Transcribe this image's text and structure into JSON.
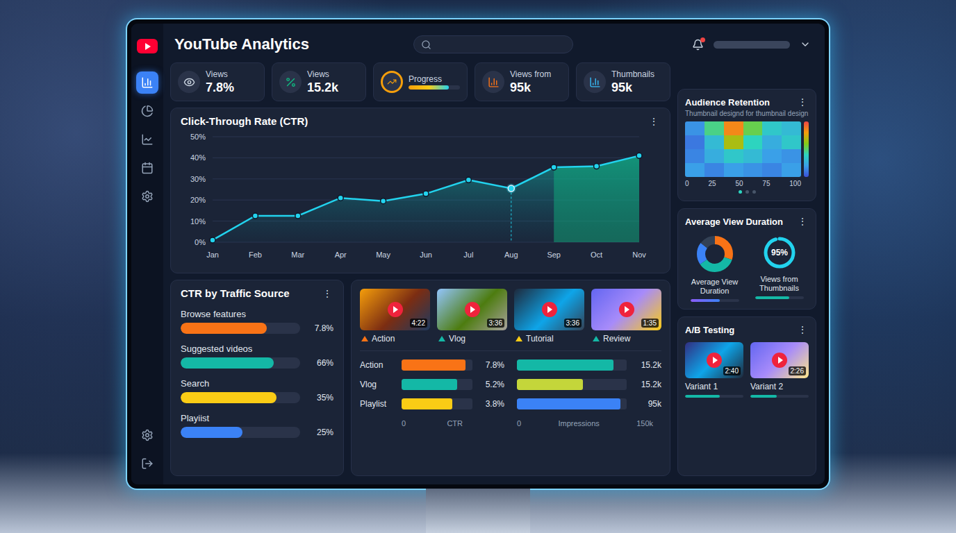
{
  "app": {
    "title": "YouTube Analytics"
  },
  "sidebar": {
    "items": [
      {
        "selected": true
      },
      {
        "selected": false
      },
      {
        "selected": false
      },
      {
        "selected": false
      },
      {
        "selected": false
      }
    ],
    "bottom_items": [
      {
        "selected": false
      },
      {
        "selected": false
      }
    ]
  },
  "notifications": {
    "unread": true
  },
  "stats": [
    {
      "kind": "stat",
      "label": "Views",
      "value": "7.8%"
    },
    {
      "kind": "stat",
      "label": "Views",
      "value": "15.2k"
    },
    {
      "kind": "progress",
      "label": "Progress",
      "level": 0.78
    },
    {
      "kind": "stat",
      "label": "Views from",
      "value": "95k"
    },
    {
      "kind": "stat",
      "label": "Thumbnails",
      "value": "95k"
    }
  ],
  "ctr_chart": {
    "title": "Click-Through Rate (CTR)",
    "menu": "⋮",
    "y_ticks": [
      "50%",
      "40%",
      "30%",
      "20%",
      "10%",
      "0%"
    ],
    "y_max": 50,
    "months": [
      {
        "label": "Jan",
        "selected": false,
        "shaded": false
      },
      {
        "label": "Feb",
        "selected": false,
        "shaded": false
      },
      {
        "label": "Mar",
        "selected": false,
        "shaded": false
      },
      {
        "label": "Apr",
        "selected": false,
        "shaded": false
      },
      {
        "label": "May",
        "selected": false,
        "shaded": false
      },
      {
        "label": "Jun",
        "selected": false,
        "shaded": false
      },
      {
        "label": "Jul",
        "selected": false,
        "shaded": false
      },
      {
        "label": "Aug",
        "selected": true,
        "shaded": false
      },
      {
        "label": "Sep",
        "selected": false,
        "shaded": true
      },
      {
        "label": "Oct",
        "selected": false,
        "shaded": true
      },
      {
        "label": "Nov",
        "selected": false,
        "shaded": true
      }
    ],
    "series": [
      {
        "values": [
          1,
          12.5,
          12.5,
          21,
          19.5,
          23,
          29.5,
          25.5,
          35.5,
          36,
          41
        ]
      }
    ]
  },
  "traffic_sources": {
    "title": "CTR by Traffic Source",
    "menu": "⋮",
    "rows": [
      {
        "label": "Browse features",
        "value": "7.8%",
        "level": 0.72,
        "color": "#f97316"
      },
      {
        "label": "Suggested videos",
        "value": "66%",
        "level": 0.78,
        "color": "#14b8a6"
      },
      {
        "label": "Search",
        "value": "35%",
        "level": 0.8,
        "color": "#facc15"
      },
      {
        "label": "Playiist",
        "value": "25%",
        "level": 0.52,
        "color": "#3b82f6"
      }
    ]
  },
  "videos": {
    "items": [
      {
        "label": "Action",
        "duration": "4:22",
        "color": "#f97316"
      },
      {
        "label": "Vlog",
        "duration": "3:36",
        "color": "#14b8a6"
      },
      {
        "label": "Tutorial",
        "duration": "3:36",
        "color": "#facc15"
      },
      {
        "label": "Review",
        "duration": "1:35",
        "color": "#14b8a6"
      }
    ],
    "ctr_bars": {
      "axis": [
        "0",
        "CTR"
      ],
      "rows": [
        {
          "label": "Action",
          "value": "7.8%",
          "level": 0.9,
          "color": "#f97316"
        },
        {
          "label": "Vlog",
          "value": "5.2%",
          "level": 0.78,
          "color": "#14b8a6"
        },
        {
          "label": "Playlist",
          "value": "3.8%",
          "level": 0.72,
          "color": "#facc15"
        }
      ]
    },
    "impression_bars": {
      "axis": [
        "0",
        "Impressions",
        "150k"
      ],
      "rows": [
        {
          "value": "15.2k",
          "level": 0.88,
          "color": "#14b8a6"
        },
        {
          "value": "15.2k",
          "level": 0.6,
          "color": "#c4d63a"
        },
        {
          "value": "95k",
          "level": 0.94,
          "color": "#3b82f6"
        }
      ]
    }
  },
  "retention": {
    "title": "Audience Retention",
    "subtitle": "Thumbnail designd for thumbnail design",
    "menu": "⋮",
    "heatmap": [
      [
        0.25,
        0.55,
        0.85,
        0.6,
        0.45,
        0.4
      ],
      [
        0.15,
        0.4,
        0.7,
        0.5,
        0.35,
        0.45
      ],
      [
        0.2,
        0.35,
        0.45,
        0.4,
        0.3,
        0.25
      ],
      [
        0.3,
        0.2,
        0.3,
        0.25,
        0.2,
        0.3
      ]
    ],
    "x_ticks": [
      "0",
      "25",
      "50",
      "75",
      "100"
    ],
    "pages": [
      {
        "selected": true
      },
      {
        "selected": false
      },
      {
        "selected": false
      }
    ]
  },
  "avg_duration": {
    "title": "Average View Duration",
    "menu": "⋮",
    "donut": {
      "label": "Average View Duration",
      "level": 0.6,
      "segments": [
        {
          "value": 0.3,
          "color": "#f97316"
        },
        {
          "value": 0.35,
          "color": "#14b8a6"
        },
        {
          "value": 0.2,
          "color": "#3b82f6"
        },
        {
          "value": 0.15,
          "color": "#334155"
        }
      ]
    },
    "ring": {
      "value": "95%",
      "level": 0.95,
      "label": "Views from Thumbnails",
      "bar_level": 0.7
    }
  },
  "ab_testing": {
    "title": "A/B Testing",
    "menu": "⋮",
    "variants": [
      {
        "label": "Variant 1",
        "duration": "2:40",
        "level": 0.6
      },
      {
        "label": "Variant 2",
        "duration": "2:26",
        "level": 0.45
      }
    ]
  }
}
